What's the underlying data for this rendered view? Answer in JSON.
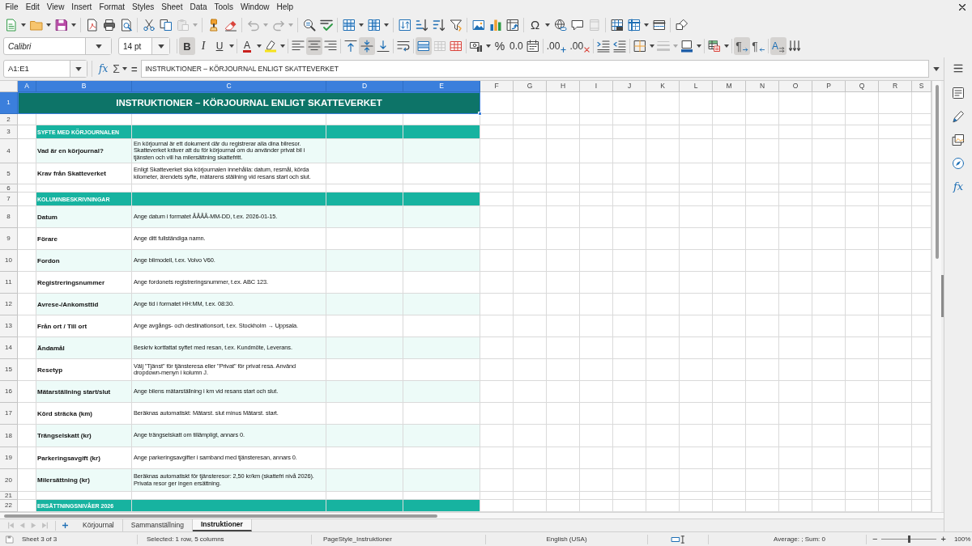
{
  "menu_bar": {
    "items": [
      "File",
      "Edit",
      "View",
      "Insert",
      "Format",
      "Styles",
      "Sheet",
      "Data",
      "Tools",
      "Window",
      "Help"
    ]
  },
  "standard_toolbar": [
    {
      "disabled": false
    },
    {
      "disabled": false
    },
    {
      "disabled": false
    },
    {
      "disabled": false
    },
    {
      "disabled": false
    },
    {
      "disabled": false
    },
    {
      "disabled": false
    },
    {
      "disabled": false
    },
    {
      "disabled": true
    },
    {
      "disabled": false
    },
    {
      "disabled": false
    },
    {
      "disabled": true
    },
    {
      "disabled": true
    },
    {
      "disabled": false
    },
    {
      "disabled": false
    },
    {
      "disabled": false
    },
    {
      "disabled": false
    },
    {
      "disabled": false
    },
    {
      "disabled": false
    },
    {
      "disabled": false
    },
    {
      "disabled": false
    },
    {
      "disabled": false
    },
    {
      "disabled": false
    },
    {
      "disabled": false
    },
    {
      "label": "Ω",
      "disabled": false
    },
    {
      "disabled": false
    },
    {
      "disabled": false
    },
    {
      "disabled": true
    },
    {
      "disabled": false
    },
    {
      "disabled": false
    },
    {
      "disabled": false
    },
    {
      "disabled": false
    }
  ],
  "formatting_toolbar": {
    "font_name": "Calibri",
    "font_size": "14 pt",
    "buttons": [
      {
        "label": "B",
        "pressed": true,
        "disabled": false
      },
      {
        "label": "I",
        "pressed": false,
        "disabled": false
      },
      {
        "label": "U",
        "pressed": false,
        "disabled": false
      },
      {
        "label": "A",
        "pressed": false,
        "disabled": false
      },
      {
        "pressed": false,
        "disabled": false
      },
      {
        "pressed": false,
        "disabled": false
      },
      {
        "pressed": true,
        "disabled": false
      },
      {
        "pressed": false,
        "disabled": false
      },
      {
        "pressed": false,
        "disabled": false
      },
      {
        "pressed": true,
        "disabled": false
      },
      {
        "pressed": false,
        "disabled": false
      },
      {
        "pressed": false,
        "disabled": false
      },
      {
        "pressed": true,
        "disabled": false
      },
      {
        "pressed": false,
        "disabled": true
      },
      {
        "pressed": false,
        "disabled": false
      },
      {
        "pressed": false,
        "disabled": false
      },
      {
        "label": "%",
        "pressed": false,
        "disabled": false
      },
      {
        "label": "0.0",
        "pressed": false,
        "disabled": false
      },
      {
        "pressed": false,
        "disabled": false
      },
      {
        "label": ".00",
        "pressed": false,
        "disabled": false
      },
      {
        "label": ".00",
        "pressed": false,
        "disabled": false
      },
      {
        "pressed": false,
        "disabled": false
      },
      {
        "pressed": false,
        "disabled": false
      },
      {
        "pressed": false,
        "disabled": false
      },
      {
        "pressed": false,
        "disabled": true
      },
      {
        "pressed": false,
        "disabled": false
      },
      {
        "pressed": false,
        "disabled": false
      },
      {
        "label": "¶",
        "pressed": true,
        "disabled": false
      },
      {
        "label": "¶",
        "pressed": false,
        "disabled": false
      },
      {
        "label": "A",
        "pressed": true,
        "disabled": false
      },
      {
        "pressed": false,
        "disabled": false
      }
    ]
  },
  "formula_bar": {
    "name_box": "A1:E1",
    "function_wizard": "fx",
    "sum": "Σ",
    "equals": "=",
    "formula": "INSTRUKTIONER – KÖRJOURNAL ENLIGT SKATTEVERKET"
  },
  "sheet": {
    "columns": [
      {
        "label": "A",
        "selected": true
      },
      {
        "label": "B",
        "selected": true
      },
      {
        "label": "C",
        "selected": true
      },
      {
        "label": "D",
        "selected": true
      },
      {
        "label": "E",
        "selected": true
      },
      {
        "label": "F",
        "selected": false
      },
      {
        "label": "G",
        "selected": false
      },
      {
        "label": "H",
        "selected": false
      },
      {
        "label": "I",
        "selected": false
      },
      {
        "label": "J",
        "selected": false
      },
      {
        "label": "K",
        "selected": false
      },
      {
        "label": "L",
        "selected": false
      },
      {
        "label": "M",
        "selected": false
      },
      {
        "label": "N",
        "selected": false
      },
      {
        "label": "O",
        "selected": false
      },
      {
        "label": "P",
        "selected": false
      },
      {
        "label": "Q",
        "selected": false
      },
      {
        "label": "R",
        "selected": false
      },
      {
        "label": "S",
        "selected": false
      }
    ],
    "rows": [
      {
        "header": "1",
        "selected": true,
        "kind": "title",
        "text": "INSTRUKTIONER – KÖRJOURNAL ENLIGT SKATTEVERKET"
      },
      {
        "header": "2",
        "selected": false,
        "kind": "blank"
      },
      {
        "header": "3",
        "selected": false,
        "kind": "section",
        "text": "SYFTE MED KÖRJOURNALEN"
      },
      {
        "header": "4",
        "selected": false,
        "kind": "item",
        "shaded": true,
        "term": "Vad är en körjournal?",
        "description": "En körjournal är ett dokument där du registrerar alla dina bilresor. Skatteverket kräver att du för körjournal om du använder privat bil i tjänsten och vill ha milersättning skattefritt."
      },
      {
        "header": "5",
        "selected": false,
        "kind": "item",
        "shaded": false,
        "term": "Krav från Skatteverket",
        "description": "Enligt Skatteverket ska körjournalen innehålla: datum, resmål, körda kilometer, ärendets syfte, mätarens ställning vid resans start och slut."
      },
      {
        "header": "6",
        "selected": false,
        "kind": "blank"
      },
      {
        "header": "7",
        "selected": false,
        "kind": "section",
        "text": "KOLUMNBESKRIVNINGAR"
      },
      {
        "header": "8",
        "selected": false,
        "kind": "item",
        "shaded": true,
        "term": "Datum",
        "description": "Ange datum i formatet ÅÅÅÅ-MM-DD, t.ex. 2026-01-15."
      },
      {
        "header": "9",
        "selected": false,
        "kind": "item",
        "shaded": false,
        "term": "Förare",
        "description": "Ange ditt fullständiga namn."
      },
      {
        "header": "10",
        "selected": false,
        "kind": "item",
        "shaded": true,
        "term": "Fordon",
        "description": "Ange bilmodell, t.ex. Volvo V60."
      },
      {
        "header": "11",
        "selected": false,
        "kind": "item",
        "shaded": false,
        "term": "Registreringsnummer",
        "description": "Ange fordonets registreringsnummer, t.ex. ABC 123."
      },
      {
        "header": "12",
        "selected": false,
        "kind": "item",
        "shaded": true,
        "term": "Avrese-/Ankomsttid",
        "description": "Ange tid i formatet HH:MM, t.ex. 08:30."
      },
      {
        "header": "13",
        "selected": false,
        "kind": "item",
        "shaded": false,
        "term": "Från ort / Till ort",
        "description": "Ange avgångs- och destinationsort, t.ex. Stockholm → Uppsala."
      },
      {
        "header": "14",
        "selected": false,
        "kind": "item",
        "shaded": true,
        "term": "Ändamål",
        "description": "Beskriv kortfattat syftet med resan, t.ex. Kundmöte, Leverans."
      },
      {
        "header": "15",
        "selected": false,
        "kind": "item",
        "shaded": false,
        "term": "Resetyp",
        "description": "Välj \"Tjänst\" för tjänsteresa eller \"Privat\" för privat resa. Använd dropdown-menyn i kolumn J."
      },
      {
        "header": "16",
        "selected": false,
        "kind": "item",
        "shaded": true,
        "term": "Mätarställning start/slut",
        "description": "Ange bilens mätarställning i km vid resans start och slut."
      },
      {
        "header": "17",
        "selected": false,
        "kind": "item",
        "shaded": false,
        "term": "Körd sträcka (km)",
        "description": "Beräknas automatiskt: Mätarst. slut minus Mätarst. start."
      },
      {
        "header": "18",
        "selected": false,
        "kind": "item",
        "shaded": true,
        "term": "Trängselskatt (kr)",
        "description": "Ange trängselskatt om tillämpligt, annars 0."
      },
      {
        "header": "19",
        "selected": false,
        "kind": "item",
        "shaded": false,
        "term": "Parkeringsavgift (kr)",
        "description": "Ange parkeringsavgifter i samband med tjänsteresan, annars 0."
      },
      {
        "header": "20",
        "selected": false,
        "kind": "item",
        "shaded": true,
        "term": "Milersättning (kr)",
        "description": "Beräknas automatiskt för tjänsteresor: 2,50 kr/km (skattefri nivå 2026). Privata resor ger ingen ersättning."
      },
      {
        "header": "21",
        "selected": false,
        "kind": "blank"
      },
      {
        "header": "22",
        "selected": false,
        "kind": "section",
        "text": "ERSÄTTNINGSNIVÅER 2026"
      }
    ]
  },
  "sheet_navigation": [
    {
      "disabled": true
    },
    {
      "disabled": true
    },
    {
      "disabled": true
    },
    {
      "disabled": true
    }
  ],
  "sheet_tabs": [
    {
      "label": "Körjournal",
      "selected": false
    },
    {
      "label": "Sammanställning",
      "selected": false
    },
    {
      "label": "Instruktioner",
      "selected": true
    }
  ],
  "sidebar": {
    "functions_label": "fx"
  },
  "status_bar": {
    "sheet": "Sheet 3 of 3",
    "selection": "Selected: 1 row, 5 columns",
    "page_style": "PageStyle_Instruktioner",
    "language": "English (USA)",
    "summary": "Average: ; Sum: 0",
    "zoom": {
      "minus": "−",
      "level": 0.5,
      "plus": "+",
      "value": "100%"
    }
  }
}
